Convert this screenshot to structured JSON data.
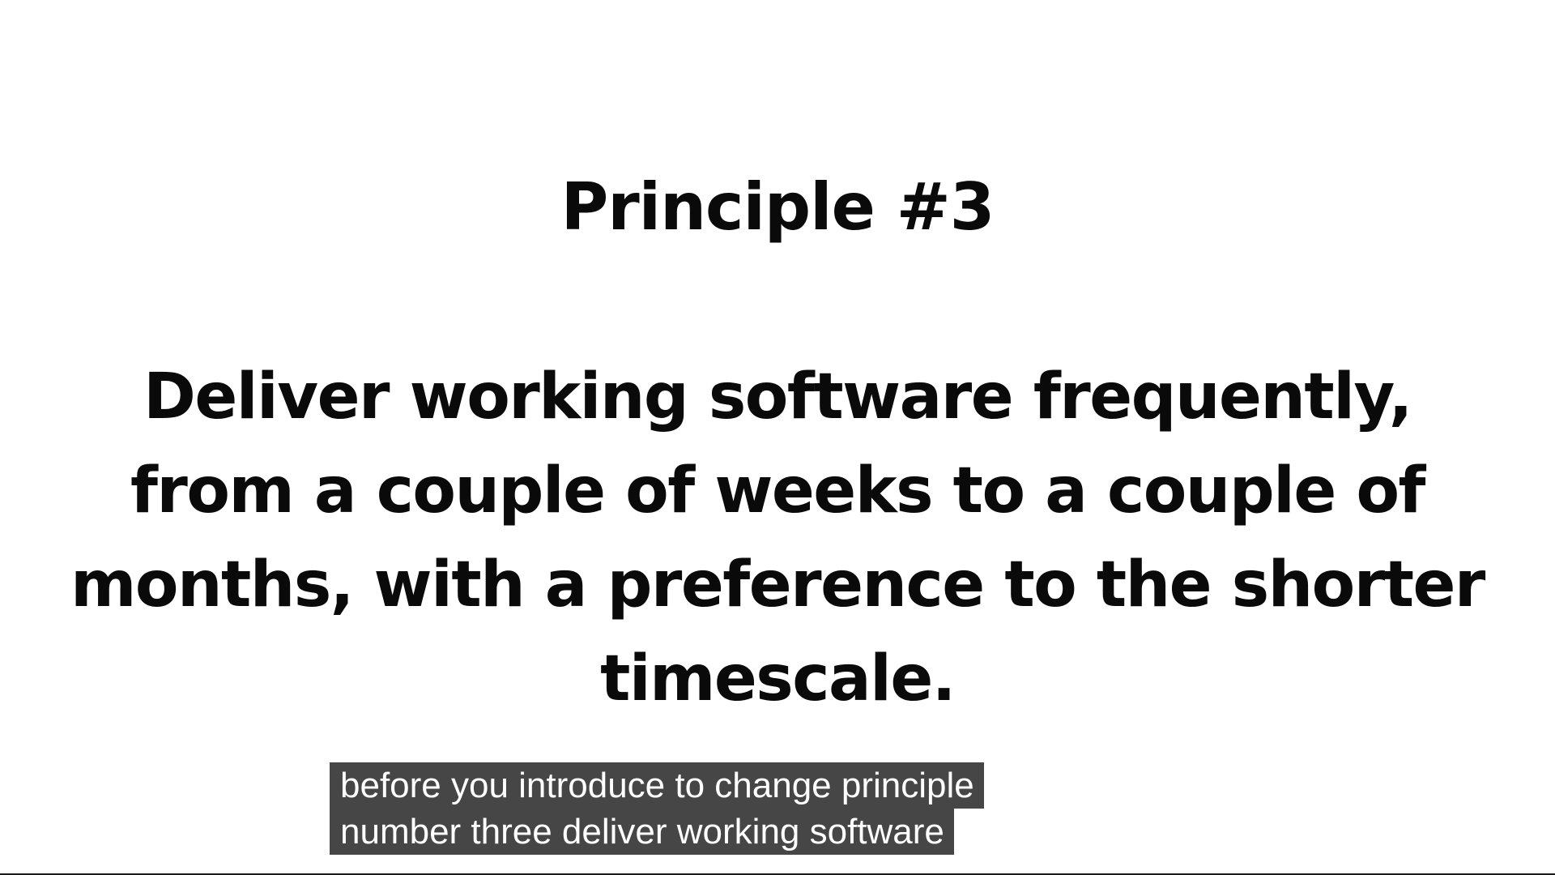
{
  "slide": {
    "title": "Principle #3",
    "body_lines": [
      "Deliver working software frequently,",
      "from a couple of weeks to a couple of",
      "months, with a preference to the shorter",
      "timescale."
    ]
  },
  "captions": {
    "lines": [
      "before you introduce to change principle",
      "number three deliver working software"
    ]
  }
}
